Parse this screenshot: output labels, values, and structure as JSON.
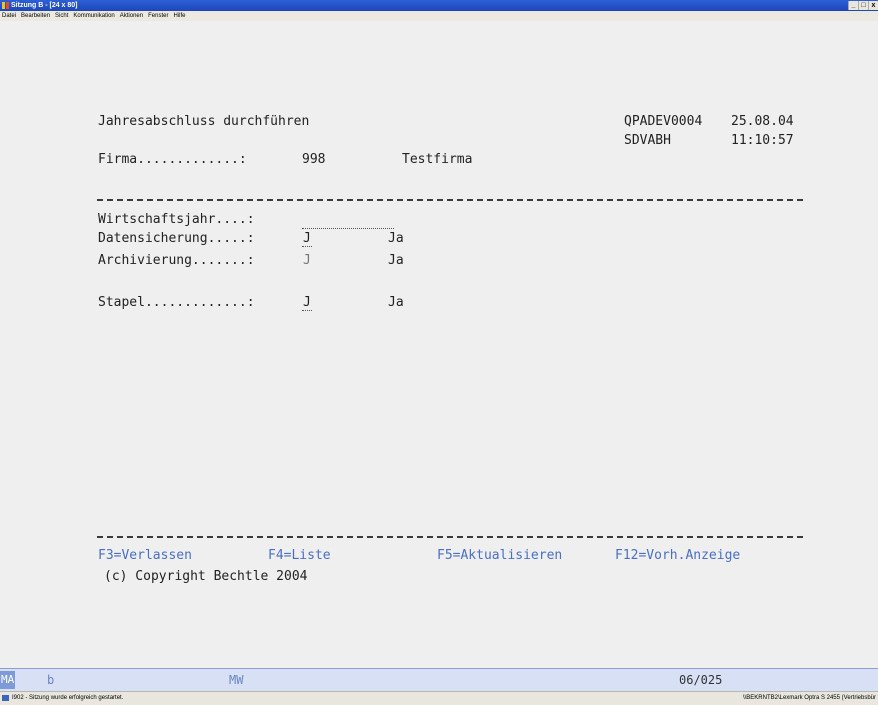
{
  "window": {
    "title": "Sitzung B - [24 x 80]",
    "buttons": [
      "_",
      "□",
      "x"
    ]
  },
  "menu": [
    "Datei",
    "Bearbeiten",
    "Sicht",
    "Kommunikation",
    "Aktionen",
    "Fenster",
    "Hilfe"
  ],
  "screen": {
    "title": "Jahresabschluss durchführen",
    "program": "QPADEV0004",
    "date": "25.08.04",
    "user": "SDVABH",
    "time": "11:10:57",
    "firma_label": "Firma.............:",
    "firma_value": "998",
    "firma_name": "Testfirma",
    "fields": {
      "wirtschaftsjahr_label": "Wirtschaftsjahr....:",
      "wirtschaftsjahr_value": "",
      "datensicherung_label": "Datensicherung.....:",
      "datensicherung_value": "J",
      "datensicherung_text": "Ja",
      "archivierung_label": "Archivierung.......:",
      "archivierung_value": "J",
      "archivierung_text": "Ja",
      "stapel_label": "Stapel.............:",
      "stapel_value": "J",
      "stapel_text": "Ja"
    },
    "fkeys": {
      "f3": "F3=Verlassen",
      "f4": "F4=Liste",
      "f5": "F5=Aktualisieren",
      "f12": "F12=Vorh.Anzeige"
    },
    "copyright": "(c) Copyright Bechtle 2004"
  },
  "oia": {
    "ma": "MA",
    "mode": "b",
    "mw": "MW",
    "cursor_pos": "06/025"
  },
  "statusbar": {
    "message": "I902 - Sitzung wurde erfolgreich gestartet.",
    "printer": "\\\\BEKRNTB2\\Lexmark Optra S 2455 (Vertriebsbür"
  },
  "colors": {
    "titlebar": "#1c47b8",
    "screen_bg": "#efefef",
    "fkey_text": "#4a6fc4",
    "oia_bg": "#d7e0f4"
  }
}
